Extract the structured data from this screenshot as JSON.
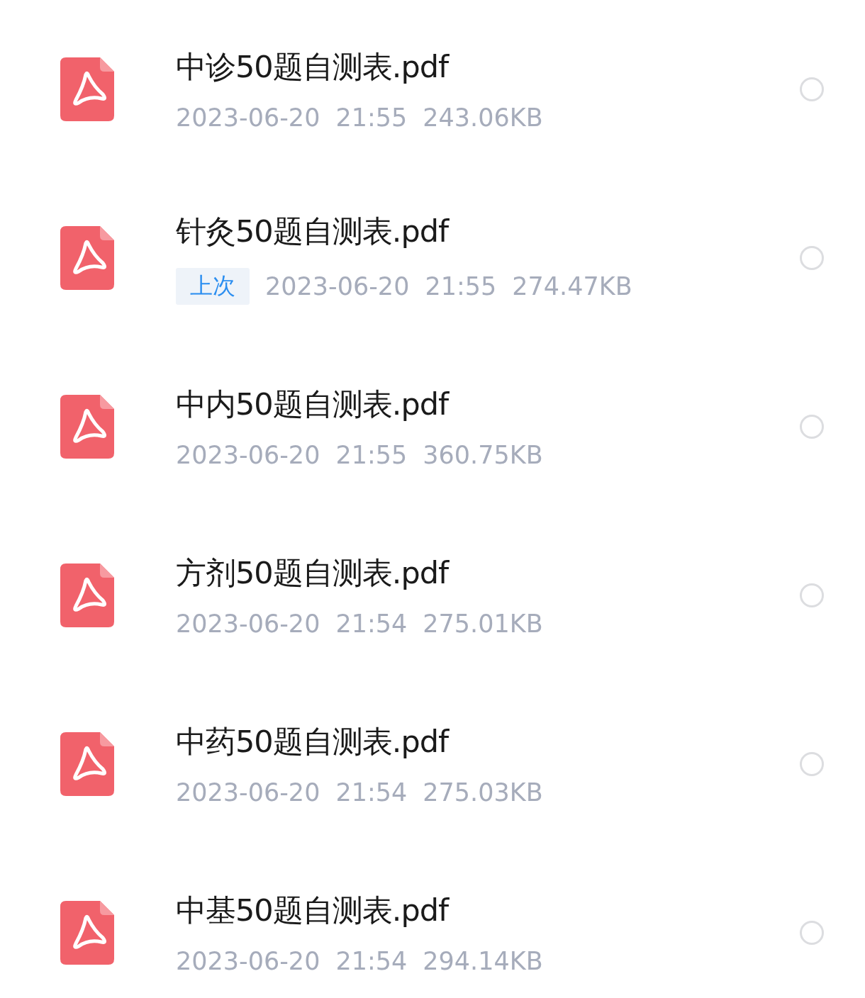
{
  "files": [
    {
      "name": "中诊50题自测表.pdf",
      "date": "2023-06-20",
      "time": "21:55",
      "size": "243.06KB",
      "selected": false
    },
    {
      "name": "针灸50题自测表.pdf",
      "tag": "上次",
      "date": "2023-06-20",
      "time": "21:55",
      "size": "274.47KB",
      "selected": false
    },
    {
      "name": "中内50题自测表.pdf",
      "date": "2023-06-20",
      "time": "21:55",
      "size": "360.75KB",
      "selected": false
    },
    {
      "name": "方剂50题自测表.pdf",
      "date": "2023-06-20",
      "time": "21:54",
      "size": "275.01KB",
      "selected": false
    },
    {
      "name": "中药50题自测表.pdf",
      "date": "2023-06-20",
      "time": "21:54",
      "size": "275.03KB",
      "selected": false
    },
    {
      "name": "中基50题自测表.pdf",
      "date": "2023-06-20",
      "time": "21:54",
      "size": "294.14KB",
      "selected": false
    }
  ]
}
